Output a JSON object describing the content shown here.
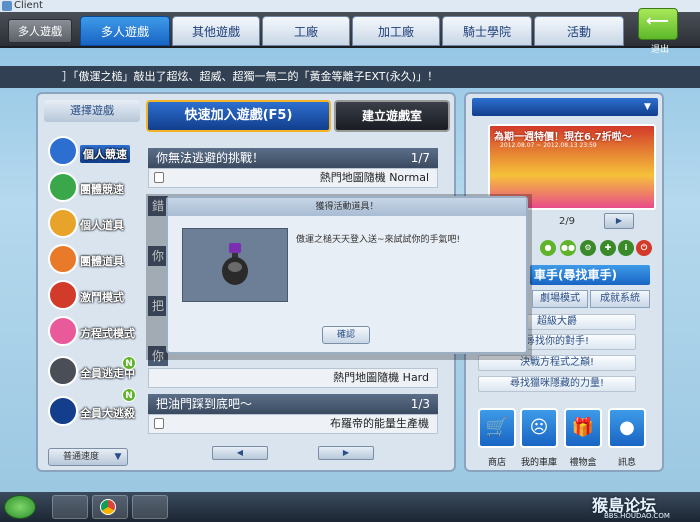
{
  "window": {
    "title": "Client"
  },
  "header": {
    "mode_label": "多人遊戲",
    "tabs": [
      {
        "label": "多人遊戲",
        "active": true
      },
      {
        "label": "其他遊戲"
      },
      {
        "label": "工廠"
      },
      {
        "label": "加工廠"
      },
      {
        "label": "騎士學院"
      },
      {
        "label": "活動"
      }
    ],
    "exit_label": "退出"
  },
  "ticker": {
    "text": "］「傲運之槌」敲出了超炫、超威、超獨一無二的「黃金等離子EXT(永久)」！"
  },
  "lobby": {
    "select_game_label": "選擇遊戲",
    "quick_join_label": "快速加入遊戲(F5)",
    "create_room_label": "建立遊戲室",
    "modes": [
      {
        "label": "個人競速",
        "active": true
      },
      {
        "label": "團體競速"
      },
      {
        "label": "個人道具"
      },
      {
        "label": "團體道具"
      },
      {
        "label": "激鬥模式"
      },
      {
        "label": "方程式模式"
      },
      {
        "label": "全員逃走中",
        "badge": "N"
      },
      {
        "label": "全員大逃殺",
        "badge": "N"
      }
    ],
    "speed_label": "普通速度",
    "rooms": [
      {
        "title": "你無法逃避的挑戰！",
        "count": "1/7",
        "map": "熱門地圖隨機 Normal"
      },
      {
        "title": "把油門踩到底吧～",
        "count": "1/3",
        "map": "布羅帝的能量生產機"
      }
    ],
    "room_peek": [
      {
        "text": "錯"
      },
      {
        "text": "你"
      },
      {
        "text": "把"
      },
      {
        "text": "你"
      }
    ],
    "hidden_room_map": "熱門地圖隨機 Hard"
  },
  "banner": {
    "text": "為期一週特價！現在6.7折啦～",
    "date": "2012.08.07 ~ 2012.08.13 23:59",
    "page": "2/9"
  },
  "right": {
    "find_racer_label": "車手(尋找車手)",
    "tabs": [
      "劇場模式",
      "成就系統"
    ],
    "links": [
      "超級大爵",
      "尋找你的對手!",
      "決戰方程式之巔!",
      "尋找獵咪隱藏的力量!"
    ],
    "quick": [
      {
        "label": "商店",
        "icon": "cart-icon"
      },
      {
        "label": "我的車庫",
        "icon": "garage-icon"
      },
      {
        "label": "禮物盒",
        "icon": "gift-icon"
      },
      {
        "label": "訊息",
        "icon": "message-icon"
      }
    ]
  },
  "dialog": {
    "title": "獲得活動道具！",
    "message": "傲運之槌天天登入送~來試試你的手氣吧!",
    "ok_label": "確認"
  },
  "watermark": {
    "text": "猴島论坛",
    "url": "BBS.HOUDAO.COM"
  },
  "colors": {
    "accent": "#1864c4",
    "highlight": "#f3b324",
    "exit": "#5cb82a"
  }
}
